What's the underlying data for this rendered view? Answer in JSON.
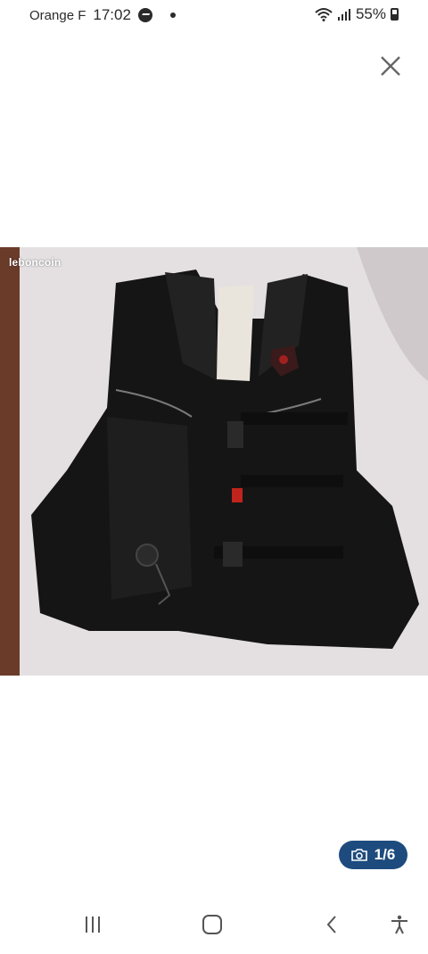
{
  "status_bar": {
    "carrier": "Orange F",
    "time": "17:02",
    "battery": "55%",
    "icons": [
      "messenger-icon",
      "notification-dot-icon",
      "wifi-icon",
      "signal-icon",
      "battery-icon"
    ]
  },
  "viewer": {
    "close_icon": "close-icon",
    "watermark": "leboncoin",
    "counter": "1/6",
    "counter_icon": "camera-icon",
    "accent_color": "#1d4b7e"
  },
  "nav_bar": {
    "icons": [
      "recent-apps-icon",
      "home-icon",
      "back-icon",
      "accessibility-icon"
    ]
  }
}
